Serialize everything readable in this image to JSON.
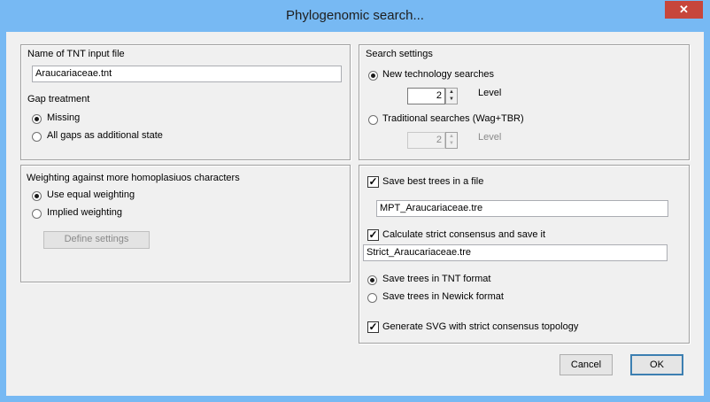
{
  "window": {
    "title": "Phylogenomic search...",
    "close_glyph": "✕"
  },
  "input_file": {
    "heading": "Name of TNT input file",
    "value": "Araucariaceae.tnt"
  },
  "gap_treatment": {
    "heading": "Gap treatment",
    "options": [
      "Missing",
      "All gaps as additional state"
    ],
    "selected": "Missing"
  },
  "weighting": {
    "heading": "Weighting against more homoplasiuos characters",
    "options": [
      "Use equal weighting",
      "Implied weighting"
    ],
    "selected": "Use equal weighting",
    "define_button": "Define settings"
  },
  "search_settings": {
    "heading": "Search settings",
    "new_tech": {
      "label": "New technology searches",
      "level": "2",
      "level_label": "Level"
    },
    "traditional": {
      "label": "Traditional searches (Wag+TBR)",
      "level": "2",
      "level_label": "Level"
    },
    "selected": "New technology searches"
  },
  "output": {
    "save_best": {
      "label": "Save best trees in a file",
      "checked": true,
      "file": "MPT_Araucariaceae.tre"
    },
    "strict": {
      "label": "Calculate strict consensus and save it",
      "checked": true,
      "file": "Strict_Araucariaceae.tre"
    },
    "format_options": [
      "Save trees in TNT format",
      "Save trees in Newick format"
    ],
    "format_selected": "Save trees in TNT format",
    "svg": {
      "label": "Generate SVG with strict consensus topology",
      "checked": true
    }
  },
  "buttons": {
    "cancel": "Cancel",
    "ok": "OK"
  },
  "icons": {
    "check": "✓",
    "spin_up": "▲",
    "spin_down": "▼"
  }
}
